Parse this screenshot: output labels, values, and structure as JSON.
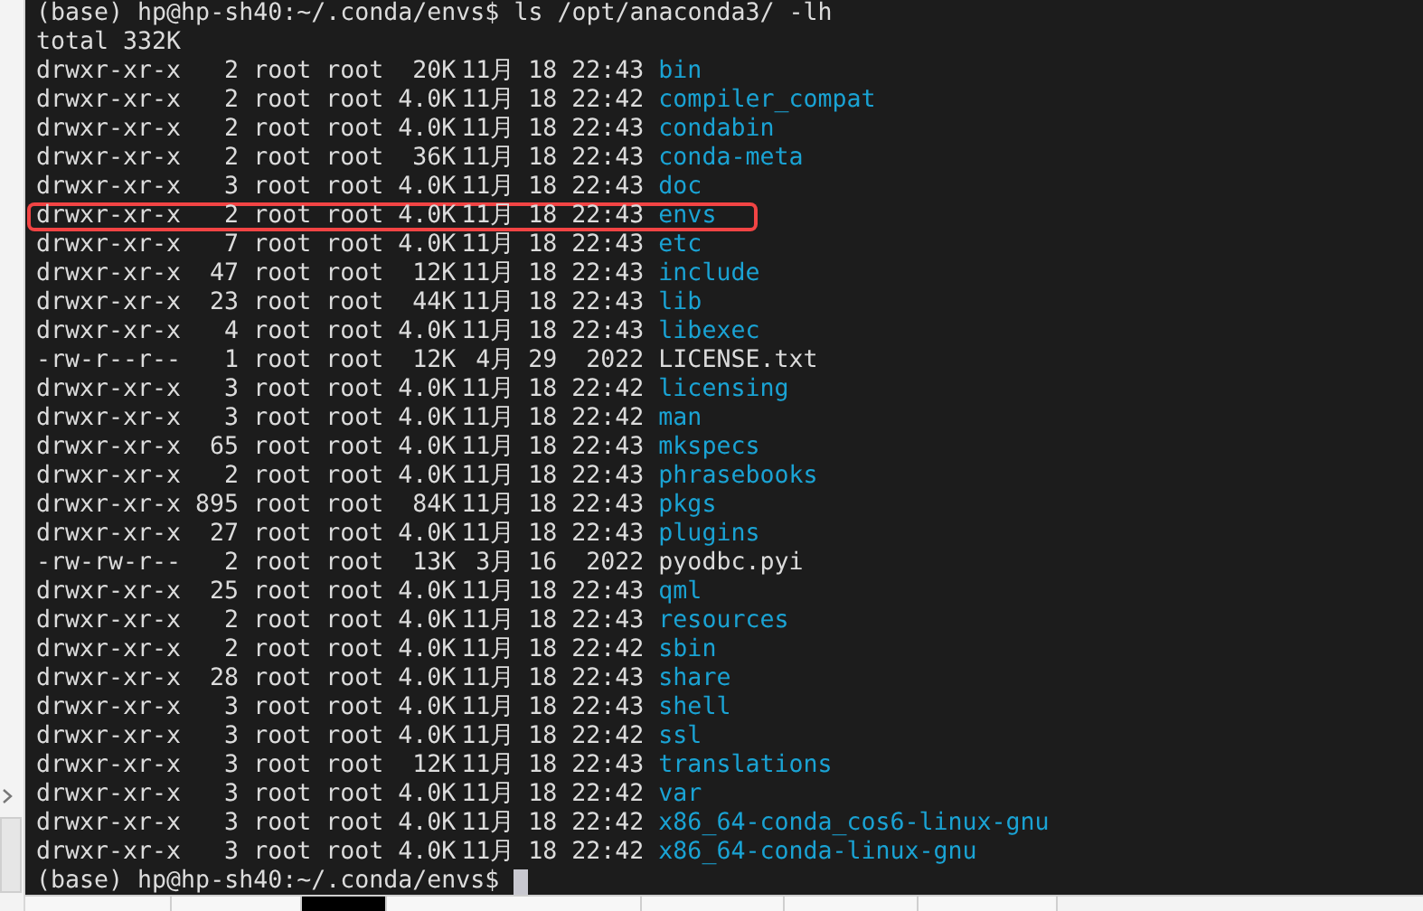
{
  "terminal": {
    "command_line": {
      "prompt": "(base) hp@hp-sh40:~/.conda/envs$",
      "command": "ls /opt/anaconda3/ -lh"
    },
    "total": "total 332K",
    "entries": [
      {
        "perms": "drwxr-xr-x",
        "links": "2",
        "owner": "root",
        "group": "root",
        "size": "20K",
        "month": "11月",
        "day": "18",
        "time": "22:43",
        "name": "bin",
        "kind": "dir",
        "highlighted": false
      },
      {
        "perms": "drwxr-xr-x",
        "links": "2",
        "owner": "root",
        "group": "root",
        "size": "4.0K",
        "month": "11月",
        "day": "18",
        "time": "22:42",
        "name": "compiler_compat",
        "kind": "dir",
        "highlighted": false
      },
      {
        "perms": "drwxr-xr-x",
        "links": "2",
        "owner": "root",
        "group": "root",
        "size": "4.0K",
        "month": "11月",
        "day": "18",
        "time": "22:43",
        "name": "condabin",
        "kind": "dir",
        "highlighted": false
      },
      {
        "perms": "drwxr-xr-x",
        "links": "2",
        "owner": "root",
        "group": "root",
        "size": "36K",
        "month": "11月",
        "day": "18",
        "time": "22:43",
        "name": "conda-meta",
        "kind": "dir",
        "highlighted": false
      },
      {
        "perms": "drwxr-xr-x",
        "links": "3",
        "owner": "root",
        "group": "root",
        "size": "4.0K",
        "month": "11月",
        "day": "18",
        "time": "22:43",
        "name": "doc",
        "kind": "dir",
        "highlighted": false
      },
      {
        "perms": "drwxr-xr-x",
        "links": "2",
        "owner": "root",
        "group": "root",
        "size": "4.0K",
        "month": "11月",
        "day": "18",
        "time": "22:43",
        "name": "envs",
        "kind": "dir",
        "highlighted": true
      },
      {
        "perms": "drwxr-xr-x",
        "links": "7",
        "owner": "root",
        "group": "root",
        "size": "4.0K",
        "month": "11月",
        "day": "18",
        "time": "22:43",
        "name": "etc",
        "kind": "dir",
        "highlighted": false
      },
      {
        "perms": "drwxr-xr-x",
        "links": "47",
        "owner": "root",
        "group": "root",
        "size": "12K",
        "month": "11月",
        "day": "18",
        "time": "22:43",
        "name": "include",
        "kind": "dir",
        "highlighted": false
      },
      {
        "perms": "drwxr-xr-x",
        "links": "23",
        "owner": "root",
        "group": "root",
        "size": "44K",
        "month": "11月",
        "day": "18",
        "time": "22:43",
        "name": "lib",
        "kind": "dir",
        "highlighted": false
      },
      {
        "perms": "drwxr-xr-x",
        "links": "4",
        "owner": "root",
        "group": "root",
        "size": "4.0K",
        "month": "11月",
        "day": "18",
        "time": "22:43",
        "name": "libexec",
        "kind": "dir",
        "highlighted": false
      },
      {
        "perms": "-rw-r--r--",
        "links": "1",
        "owner": "root",
        "group": "root",
        "size": "12K",
        "month": "4月",
        "day": "29",
        "time": "2022",
        "name": "LICENSE.txt",
        "kind": "file",
        "highlighted": false
      },
      {
        "perms": "drwxr-xr-x",
        "links": "3",
        "owner": "root",
        "group": "root",
        "size": "4.0K",
        "month": "11月",
        "day": "18",
        "time": "22:42",
        "name": "licensing",
        "kind": "dir",
        "highlighted": false
      },
      {
        "perms": "drwxr-xr-x",
        "links": "3",
        "owner": "root",
        "group": "root",
        "size": "4.0K",
        "month": "11月",
        "day": "18",
        "time": "22:42",
        "name": "man",
        "kind": "dir",
        "highlighted": false
      },
      {
        "perms": "drwxr-xr-x",
        "links": "65",
        "owner": "root",
        "group": "root",
        "size": "4.0K",
        "month": "11月",
        "day": "18",
        "time": "22:43",
        "name": "mkspecs",
        "kind": "dir",
        "highlighted": false
      },
      {
        "perms": "drwxr-xr-x",
        "links": "2",
        "owner": "root",
        "group": "root",
        "size": "4.0K",
        "month": "11月",
        "day": "18",
        "time": "22:43",
        "name": "phrasebooks",
        "kind": "dir",
        "highlighted": false
      },
      {
        "perms": "drwxr-xr-x",
        "links": "895",
        "owner": "root",
        "group": "root",
        "size": "84K",
        "month": "11月",
        "day": "18",
        "time": "22:43",
        "name": "pkgs",
        "kind": "dir",
        "highlighted": false
      },
      {
        "perms": "drwxr-xr-x",
        "links": "27",
        "owner": "root",
        "group": "root",
        "size": "4.0K",
        "month": "11月",
        "day": "18",
        "time": "22:43",
        "name": "plugins",
        "kind": "dir",
        "highlighted": false
      },
      {
        "perms": "-rw-rw-r--",
        "links": "2",
        "owner": "root",
        "group": "root",
        "size": "13K",
        "month": "3月",
        "day": "16",
        "time": "2022",
        "name": "pyodbc.pyi",
        "kind": "file",
        "highlighted": false
      },
      {
        "perms": "drwxr-xr-x",
        "links": "25",
        "owner": "root",
        "group": "root",
        "size": "4.0K",
        "month": "11月",
        "day": "18",
        "time": "22:43",
        "name": "qml",
        "kind": "dir",
        "highlighted": false
      },
      {
        "perms": "drwxr-xr-x",
        "links": "2",
        "owner": "root",
        "group": "root",
        "size": "4.0K",
        "month": "11月",
        "day": "18",
        "time": "22:43",
        "name": "resources",
        "kind": "dir",
        "highlighted": false
      },
      {
        "perms": "drwxr-xr-x",
        "links": "2",
        "owner": "root",
        "group": "root",
        "size": "4.0K",
        "month": "11月",
        "day": "18",
        "time": "22:42",
        "name": "sbin",
        "kind": "dir",
        "highlighted": false
      },
      {
        "perms": "drwxr-xr-x",
        "links": "28",
        "owner": "root",
        "group": "root",
        "size": "4.0K",
        "month": "11月",
        "day": "18",
        "time": "22:43",
        "name": "share",
        "kind": "dir",
        "highlighted": false
      },
      {
        "perms": "drwxr-xr-x",
        "links": "3",
        "owner": "root",
        "group": "root",
        "size": "4.0K",
        "month": "11月",
        "day": "18",
        "time": "22:43",
        "name": "shell",
        "kind": "dir",
        "highlighted": false
      },
      {
        "perms": "drwxr-xr-x",
        "links": "3",
        "owner": "root",
        "group": "root",
        "size": "4.0K",
        "month": "11月",
        "day": "18",
        "time": "22:42",
        "name": "ssl",
        "kind": "dir",
        "highlighted": false
      },
      {
        "perms": "drwxr-xr-x",
        "links": "3",
        "owner": "root",
        "group": "root",
        "size": "12K",
        "month": "11月",
        "day": "18",
        "time": "22:43",
        "name": "translations",
        "kind": "dir",
        "highlighted": false
      },
      {
        "perms": "drwxr-xr-x",
        "links": "3",
        "owner": "root",
        "group": "root",
        "size": "4.0K",
        "month": "11月",
        "day": "18",
        "time": "22:42",
        "name": "var",
        "kind": "dir",
        "highlighted": false
      },
      {
        "perms": "drwxr-xr-x",
        "links": "3",
        "owner": "root",
        "group": "root",
        "size": "4.0K",
        "month": "11月",
        "day": "18",
        "time": "22:42",
        "name": "x86_64-conda_cos6-linux-gnu",
        "kind": "dir",
        "highlighted": false
      },
      {
        "perms": "drwxr-xr-x",
        "links": "3",
        "owner": "root",
        "group": "root",
        "size": "4.0K",
        "month": "11月",
        "day": "18",
        "time": "22:42",
        "name": "x86_64-conda-linux-gnu",
        "kind": "dir",
        "highlighted": false
      }
    ],
    "final_prompt": "(base) hp@hp-sh40:~/.conda/envs$"
  }
}
